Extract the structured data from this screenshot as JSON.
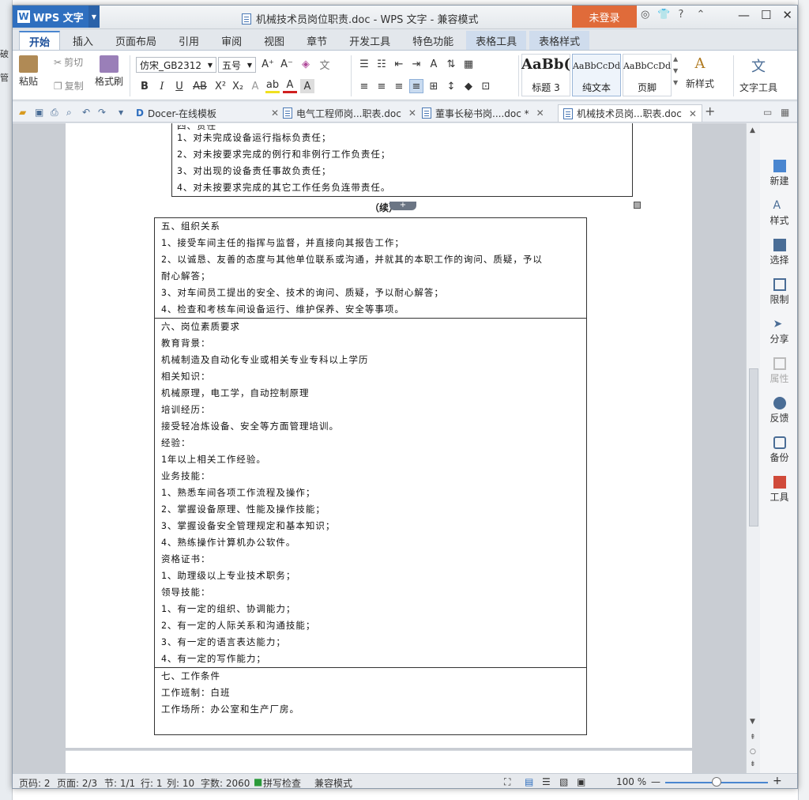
{
  "background": {
    "left_labels": [
      "破",
      "管"
    ]
  },
  "titlebar": {
    "app_name": "WPS 文字",
    "doc_title": "机械技术员岗位职责.doc - WPS 文字 - 兼容模式",
    "login": "未登录",
    "help": "?"
  },
  "ribbon_tabs": [
    "开始",
    "插入",
    "页面布局",
    "引用",
    "审阅",
    "视图",
    "章节",
    "开发工具",
    "特色功能",
    "表格工具",
    "表格样式"
  ],
  "ribbon": {
    "paste": "粘贴",
    "cut": "剪切",
    "copy": "复制",
    "format_painter": "格式刷",
    "font_name": "仿宋_GB2312",
    "font_size": "五号",
    "styles": [
      {
        "preview": "AaBb(",
        "label": "标题 3"
      },
      {
        "preview": "AaBbCcDd",
        "label": "纯文本"
      },
      {
        "preview": "AaBbCcDd",
        "label": "页脚"
      }
    ],
    "new_style": "新样式",
    "text_tools": "文字工具"
  },
  "doc_tabs": [
    {
      "label": "Docer-在线模板"
    },
    {
      "label": "电气工程师岗...职表.doc"
    },
    {
      "label": "董事长秘书岗....doc *"
    },
    {
      "label": "机械技术员岗...职表.doc"
    }
  ],
  "document": {
    "cont_lines": [
      "1、对未完成设备运行指标负责任；",
      "2、对未按要求完成的例行和非例行工作负责任；",
      "3、对出现的设备责任事故负责任；",
      "4、对未按要求完成的其它工作任务负连带责任。"
    ],
    "cont_label": "（续）",
    "section5": [
      "五、组织关系",
      "1、接受车间主任的指挥与监督，并直接向其报告工作；",
      "2、以诚恳、友善的态度与其他单位联系或沟通，并就其的本职工作的询问、质疑，予以",
      "耐心解答；",
      "3、对车间员工提出的安全、技术的询问、质疑，予以耐心解答；",
      "4、检查和考核车间设备运行、维护保养、安全等事项。"
    ],
    "section6": [
      "六、岗位素质要求",
      "教育背景：",
      "机械制造及自动化专业或相关专业专科以上学历",
      "相关知识：",
      "机械原理，电工学，自动控制原理",
      "培训经历：",
      "接受轻冶炼设备、安全等方面管理培训。",
      "经验：",
      "1年以上相关工作经验。",
      "业务技能：",
      "1、熟悉车间各项工作流程及操作；",
      "2、掌握设备原理、性能及操作技能；",
      "3、掌握设备安全管理规定和基本知识；",
      "4、熟练操作计算机办公软件。",
      "资格证书：",
      "1、助理级以上专业技术职务；",
      "领导技能：",
      "1、有一定的组织、协调能力；",
      "2、有一定的人际关系和沟通技能；",
      "3、有一定的语言表达能力；",
      "4、有一定的写作能力；"
    ],
    "section7": [
      "七、工作条件",
      "工作班制：白班",
      "工作场所：办公室和生产厂房。"
    ]
  },
  "right_panel": [
    "新建",
    "样式",
    "选择",
    "限制",
    "分享",
    "属性",
    "反馈",
    "备份",
    "工具"
  ],
  "statusbar": {
    "page_code": "页码: 2",
    "page": "页面: 2/3",
    "section": "节: 1/1",
    "row": "行: 1",
    "col": "列: 10",
    "words": "字数: 2060",
    "spell": "拼写检查",
    "mode": "兼容模式",
    "zoom": "100 %"
  },
  "colors": {
    "accent": "#2f6fbf",
    "login": "#e06b3a",
    "tool_tab": "#cfdced"
  }
}
